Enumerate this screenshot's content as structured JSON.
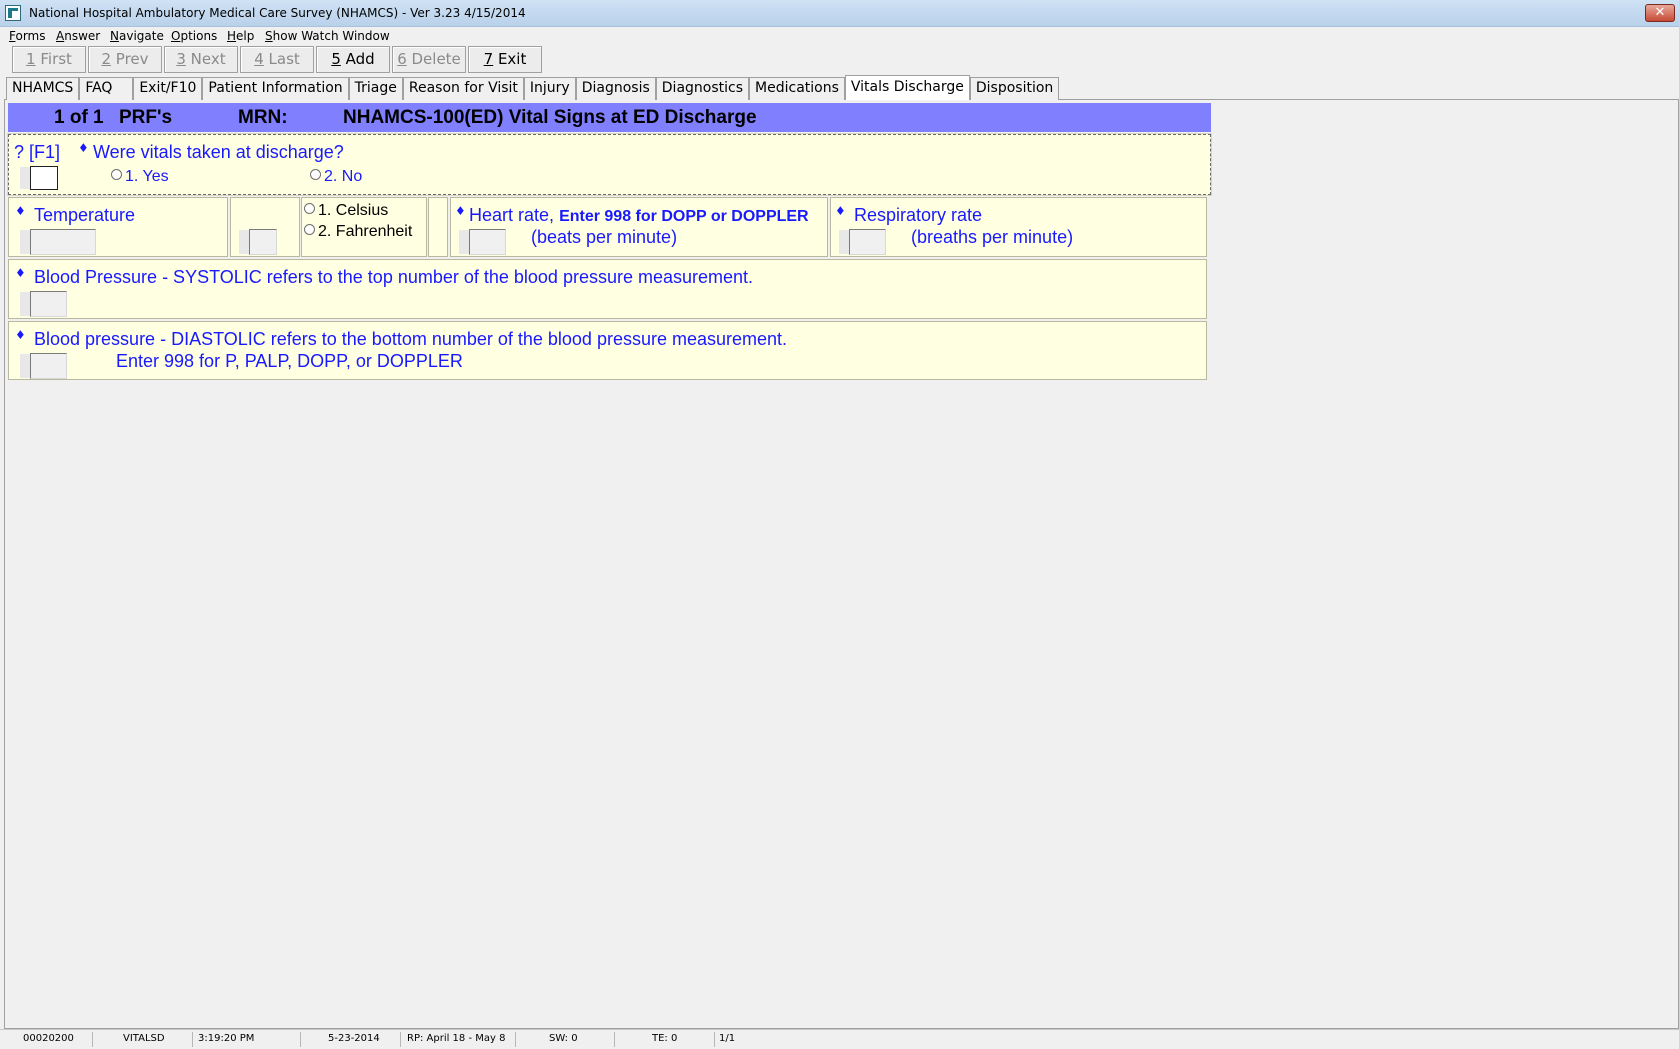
{
  "window": {
    "title": "National Hospital Ambulatory Medical Care Survey (NHAMCS) - Ver 3.23 4/15/2014",
    "close_label": "✕"
  },
  "menu": [
    {
      "label": "Forms",
      "mnemonic": "F",
      "rest": "orms"
    },
    {
      "label": "Answer",
      "mnemonic": "A",
      "rest": "nswer"
    },
    {
      "label": "Navigate",
      "mnemonic": "N",
      "rest": "avigate"
    },
    {
      "label": "Options",
      "mnemonic": "O",
      "rest": "ptions"
    },
    {
      "label": "Help",
      "mnemonic": "H",
      "rest": "elp"
    },
    {
      "label": "Show Watch Window",
      "mnemonic": "S",
      "rest": "how Watch Window"
    }
  ],
  "toolbar": [
    {
      "num": "1",
      "label": " First",
      "enabled": false
    },
    {
      "num": "2",
      "label": " Prev",
      "enabled": false
    },
    {
      "num": "3",
      "label": " Next",
      "enabled": false
    },
    {
      "num": "4",
      "label": " Last",
      "enabled": false
    },
    {
      "num": "5",
      "label": " Add",
      "enabled": true
    },
    {
      "num": "6",
      "label": " Delete",
      "enabled": false
    },
    {
      "num": "7",
      "label": " Exit",
      "enabled": true
    }
  ],
  "tabs": [
    {
      "label": "NHAMCS",
      "active": false
    },
    {
      "label": "FAQ",
      "active": false
    },
    {
      "label": "Exit/F10",
      "active": false
    },
    {
      "label": "Patient Information",
      "active": false
    },
    {
      "label": "Triage",
      "active": false
    },
    {
      "label": "Reason for Visit",
      "active": false
    },
    {
      "label": "Injury",
      "active": false
    },
    {
      "label": "Diagnosis",
      "active": false
    },
    {
      "label": "Diagnostics",
      "active": false
    },
    {
      "label": "Medications",
      "active": false
    },
    {
      "label": "Vitals Discharge",
      "active": true
    },
    {
      "label": "Disposition",
      "active": false
    }
  ],
  "form": {
    "record": "1 of 1",
    "prf": "PRF's",
    "mrn_label": "MRN:",
    "title": "NHAMCS-100(ED) Vital Signs at ED Discharge"
  },
  "q_vitals": {
    "help": "? [F1]",
    "diamond": "♦",
    "question": "Were vitals taken at discharge?",
    "options": [
      "1. Yes",
      "2. No"
    ],
    "value": ""
  },
  "temperature": {
    "diamond": "♦",
    "label": "Temperature",
    "value": "",
    "unit_value": "",
    "units": [
      "1. Celsius",
      "2. Fahrenheit"
    ]
  },
  "heart_rate": {
    "diamond": "♦",
    "label": "Heart rate,",
    "note": "Enter 998 for DOPP or DOPPLER",
    "unit": "(beats per minute)",
    "value": ""
  },
  "respiratory": {
    "diamond": "♦",
    "label": "Respiratory rate",
    "unit": "(breaths per minute)",
    "value": ""
  },
  "systolic": {
    "diamond": "♦",
    "label": "Blood Pressure - SYSTOLIC refers to the top number of the blood pressure measurement.",
    "value": ""
  },
  "diastolic": {
    "diamond": "♦",
    "label": "Blood pressure - DIASTOLIC refers to the bottom number of the blood pressure measurement.",
    "note": "Enter 998 for P, PALP, DOPP, or DOPPLER",
    "value": ""
  },
  "status": {
    "case_id": "00020200",
    "field": "VITALSD",
    "time": "3:19:20 PM",
    "date": "5-23-2014",
    "rp": "RP: April 18  - May 8",
    "sw": "SW: 0",
    "te": "TE: 0",
    "page": "1/1"
  }
}
